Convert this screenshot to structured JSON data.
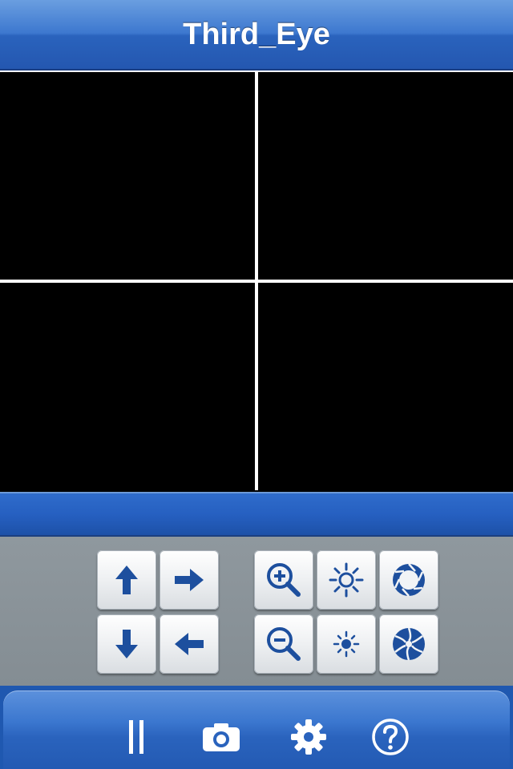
{
  "app": {
    "title": "Third_Eye"
  },
  "camera_grid": {
    "cells": [
      "camera-view-1",
      "camera-view-2",
      "camera-view-3",
      "camera-view-4"
    ]
  },
  "controls": {
    "pan_tilt": [
      {
        "name": "tilt-up-button",
        "icon": "arrow-up-icon"
      },
      {
        "name": "pan-right-button",
        "icon": "arrow-right-icon"
      },
      {
        "name": "tilt-down-button",
        "icon": "arrow-down-icon"
      },
      {
        "name": "pan-left-button",
        "icon": "arrow-left-icon"
      }
    ],
    "lens": [
      {
        "name": "zoom-in-button",
        "icon": "zoom-in-icon"
      },
      {
        "name": "brightness-up-button",
        "icon": "brightness-up-icon"
      },
      {
        "name": "iris-open-button",
        "icon": "iris-open-icon"
      },
      {
        "name": "zoom-out-button",
        "icon": "zoom-out-icon"
      },
      {
        "name": "brightness-down-button",
        "icon": "brightness-down-icon"
      },
      {
        "name": "iris-close-button",
        "icon": "iris-close-icon"
      }
    ]
  },
  "toolbar": {
    "items": [
      {
        "name": "pause-button",
        "icon": "pause-icon"
      },
      {
        "name": "snapshot-button",
        "icon": "camera-icon"
      },
      {
        "name": "settings-button",
        "icon": "gear-icon"
      },
      {
        "name": "help-button",
        "icon": "help-icon"
      }
    ]
  },
  "colors": {
    "accent_blue": "#2a63bd",
    "icon_blue": "#1d4f9e",
    "control_panel_gray": "#8a9399"
  }
}
